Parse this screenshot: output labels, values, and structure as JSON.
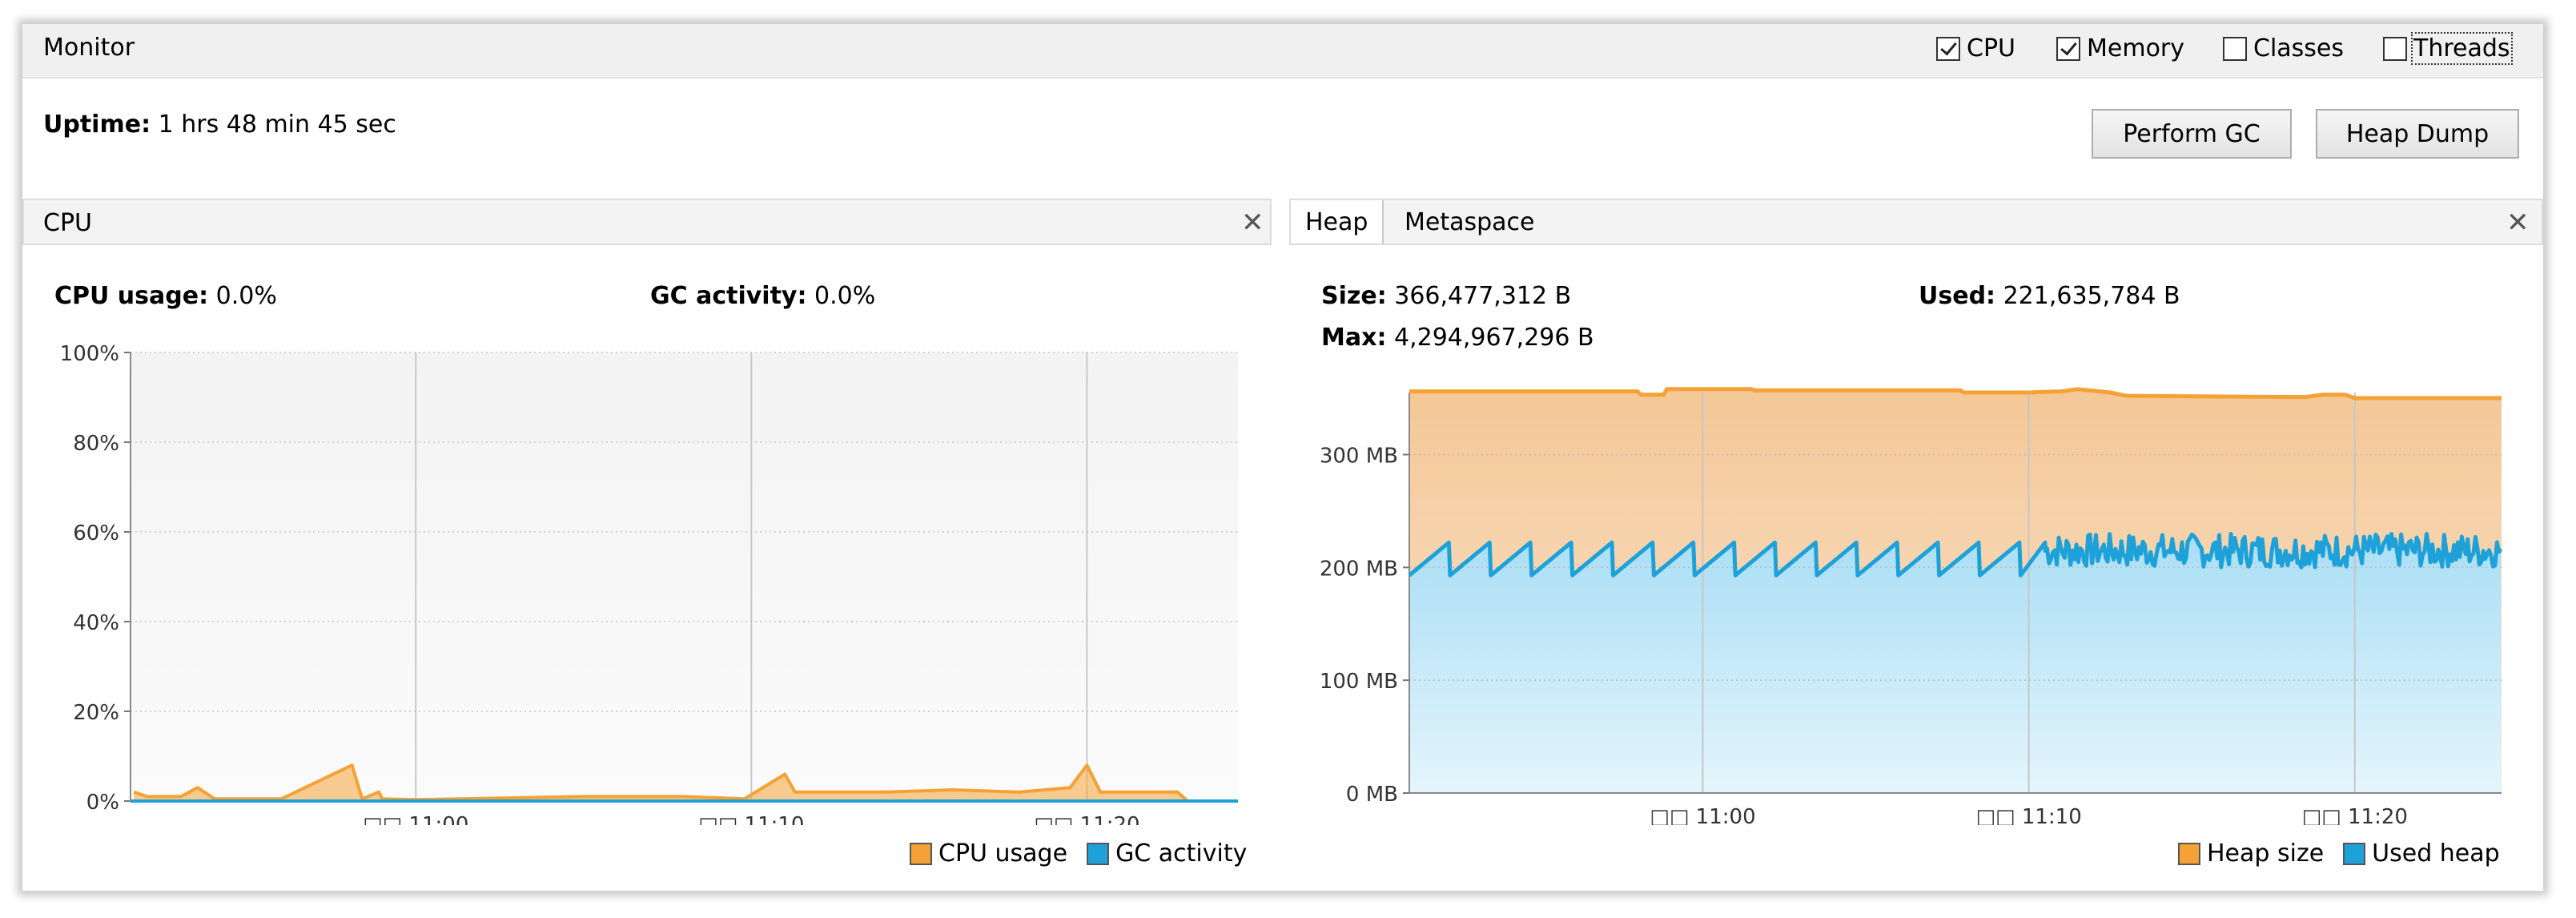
{
  "monitor": {
    "title": "Monitor",
    "checkboxes": [
      {
        "label": "CPU",
        "checked": true
      },
      {
        "label": "Memory",
        "checked": true
      },
      {
        "label": "Classes",
        "checked": false
      },
      {
        "label": "Threads",
        "checked": false
      }
    ],
    "uptime_label": "Uptime:",
    "uptime_value": "1 hrs 48 min 45 sec",
    "buttons": {
      "gc": "Perform GC",
      "heap_dump": "Heap Dump"
    }
  },
  "cpu_panel": {
    "title": "CPU",
    "close_icon": "close-icon",
    "usage_label": "CPU usage:",
    "usage_value": "0.0%",
    "gc_label": "GC activity:",
    "gc_value": "0.0%",
    "legend": [
      {
        "label": "CPU usage",
        "color": "#f4a236"
      },
      {
        "label": "GC activity",
        "color": "#1ea1d9"
      }
    ]
  },
  "memory_panel": {
    "tabs": [
      "Heap",
      "Metaspace"
    ],
    "active_tab": "Heap",
    "close_icon": "close-icon",
    "size_label": "Size:",
    "size_value": "366,477,312 B",
    "used_label": "Used:",
    "used_value": "221,635,784 B",
    "max_label": "Max:",
    "max_value": "4,294,967,296 B",
    "legend": [
      {
        "label": "Heap size",
        "color": "#f4a236"
      },
      {
        "label": "Used heap",
        "color": "#1ea1d9"
      }
    ]
  },
  "colors": {
    "orange": "#f4a236",
    "blue": "#1ea1d9",
    "heap_fill": "#f7d4a9",
    "used_fill": "#c9ebf8"
  },
  "chart_data": [
    {
      "type": "line",
      "title": "",
      "x_tick_labels": [
        "□□ 11:00",
        "□□ 11:10",
        "□□ 11:20"
      ],
      "x_range_minutes": [
        -8.5,
        24.5
      ],
      "y_tick_labels": [
        "0%",
        "20%",
        "40%",
        "60%",
        "80%",
        "100%"
      ],
      "ylim": [
        0,
        100
      ],
      "series": [
        {
          "name": "CPU usage",
          "points": [
            [
              -8.4,
              2
            ],
            [
              -8.0,
              1
            ],
            [
              -7.0,
              1
            ],
            [
              -6.5,
              3
            ],
            [
              -6,
              0.5
            ],
            [
              -4,
              0.5
            ],
            [
              -1.9,
              8
            ],
            [
              -1.6,
              0.5
            ],
            [
              -1.1,
              2
            ],
            [
              -1,
              0.5
            ],
            [
              0,
              0.3
            ],
            [
              5,
              1
            ],
            [
              8,
              1
            ],
            [
              9.8,
              0.5
            ],
            [
              11,
              6
            ],
            [
              11.3,
              2
            ],
            [
              12,
              2
            ],
            [
              14,
              2
            ],
            [
              16,
              2.5
            ],
            [
              18,
              2
            ],
            [
              19.5,
              3
            ],
            [
              20,
              8
            ],
            [
              20.4,
              2
            ],
            [
              21,
              2
            ],
            [
              22,
              2
            ],
            [
              22.7,
              2
            ],
            [
              23,
              0
            ]
          ]
        },
        {
          "name": "GC activity",
          "points": [
            [
              -8.5,
              0
            ],
            [
              24.5,
              0
            ]
          ]
        }
      ]
    },
    {
      "type": "area",
      "title": "",
      "x_tick_labels": [
        "□□ 11:00",
        "□□ 11:10",
        "□□ 11:20"
      ],
      "x_range_minutes": [
        -9,
        24.5
      ],
      "y_tick_labels": [
        "0 MB",
        "100 MB",
        "200 MB",
        "300 MB"
      ],
      "ylim": [
        0,
        355
      ],
      "series": [
        {
          "name": "Heap size",
          "points": [
            [
              -9,
              356
            ],
            [
              -2,
              356
            ],
            [
              -1.9,
              353
            ],
            [
              -1.2,
              353
            ],
            [
              -1.1,
              358
            ],
            [
              1.5,
              358
            ],
            [
              1.6,
              357
            ],
            [
              7.9,
              357
            ],
            [
              8,
              355
            ],
            [
              10,
              355
            ],
            [
              11,
              356
            ],
            [
              11.5,
              358
            ],
            [
              12.5,
              355
            ],
            [
              13,
              352
            ],
            [
              18.5,
              351
            ],
            [
              19,
              353
            ],
            [
              19.7,
              353
            ],
            [
              20,
              350
            ],
            [
              24.5,
              350
            ]
          ]
        },
        {
          "name": "Used heap",
          "sawtooth": {
            "start_min": -9,
            "end_min": 10.5,
            "low_mb": 193,
            "high_mb": 222,
            "period_min": 1.25
          },
          "noisy_band": {
            "start_min": 10.5,
            "end_min": 24.5,
            "low_mb": 200,
            "high_mb": 230
          }
        }
      ]
    }
  ]
}
